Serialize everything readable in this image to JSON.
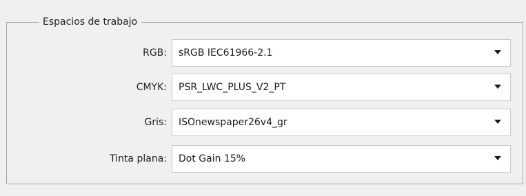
{
  "group": {
    "title": "Espacios de trabajo"
  },
  "rows": [
    {
      "label": "RGB:",
      "value": "sRGB IEC61966-2.1"
    },
    {
      "label": "CMYK:",
      "value": "PSR_LWC_PLUS_V2_PT"
    },
    {
      "label": "Gris:",
      "value": "ISOnewspaper26v4_gr"
    },
    {
      "label": "Tinta plana:",
      "value": "Dot Gain 15%"
    }
  ],
  "icons": {
    "dropdown": "chevron-down-icon"
  }
}
